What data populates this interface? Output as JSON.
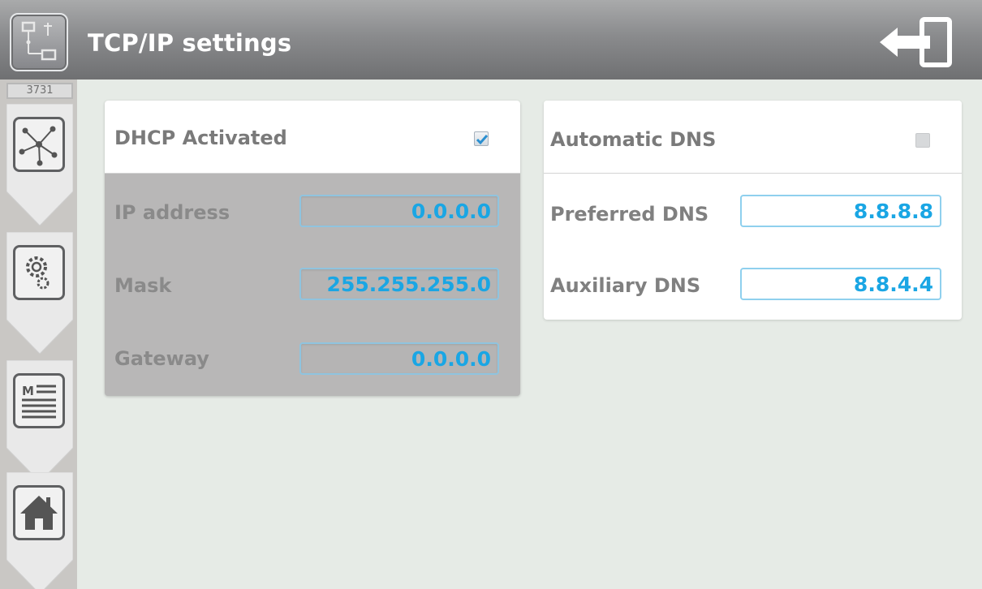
{
  "header": {
    "title": "TCP/IP settings",
    "app_icon": "network-settings-icon",
    "exit_icon": "exit-icon"
  },
  "sidebar": {
    "version": "3731",
    "tabs": [
      {
        "icon": "network-topology-icon"
      },
      {
        "icon": "gears-icon"
      },
      {
        "icon": "memo-list-icon"
      },
      {
        "icon": "home-icon"
      }
    ]
  },
  "dhcp_panel": {
    "toggle_label": "DHCP Activated",
    "checked": true,
    "fields": [
      {
        "label": "IP address",
        "value": "0.0.0.0"
      },
      {
        "label": "Mask",
        "value": "255.255.255.0"
      },
      {
        "label": "Gateway",
        "value": "0.0.0.0"
      }
    ]
  },
  "dns_panel": {
    "toggle_label": "Automatic DNS",
    "checked": false,
    "fields": [
      {
        "label": "Preferred DNS",
        "value": "8.8.8.8"
      },
      {
        "label": "Auxiliary DNS",
        "value": "8.8.4.4"
      }
    ]
  },
  "colors": {
    "value_text": "#1aa6e4",
    "header_dark": "#6f7072",
    "panel_disabled": "#b8b7b7"
  }
}
